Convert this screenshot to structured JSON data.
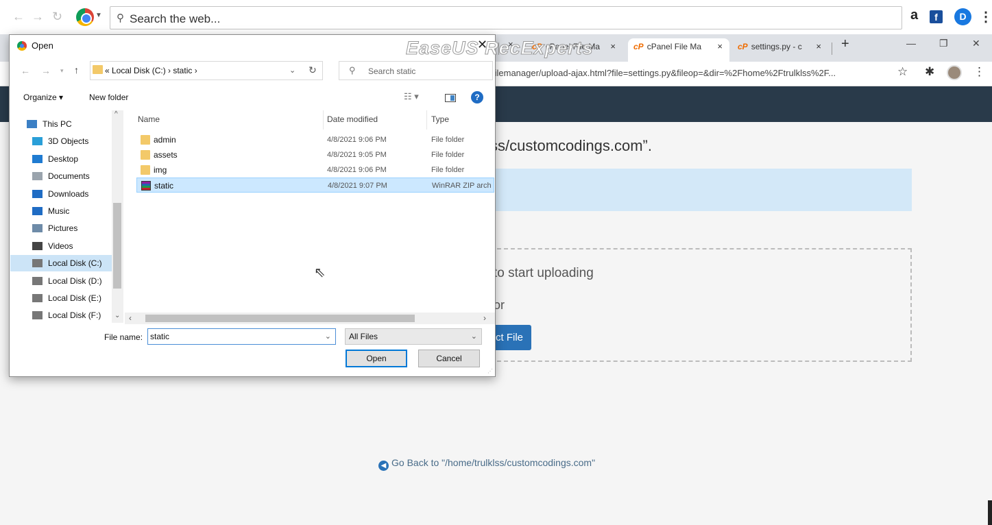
{
  "browser": {
    "search_text": "Search the web...",
    "address_url": "filemanager/upload-ajax.html?file=settings.py&fileop=&dir=%2Fhome%2Ftrulklss%2F...",
    "extensions": {
      "amazon": "a",
      "facebook": "f",
      "d_icon": "D"
    },
    "tabs": [
      {
        "label": "cPanel File Ma",
        "active": false
      },
      {
        "label": "cPanel File Ma",
        "active": true
      },
      {
        "label": "settings.py - c",
        "active": false
      }
    ],
    "cp_logo": "cP",
    "new_tab": "+",
    "tab_close": "×"
  },
  "watermark": "EaseUS RecExperts",
  "page": {
    "heading": "ss/customcodings.com”.",
    "dropzone_line1": "to start uploading",
    "dropzone_line2": "or",
    "select_button": "ct File",
    "go_back": "Go Back to \"/home/trulklss/customcodings.com\""
  },
  "dialog": {
    "title": "Open",
    "breadcrumb": "«  Local Disk (C:)  ›  static  ›",
    "search_placeholder": "Search static",
    "organize": "Organize ▾",
    "new_folder": "New folder",
    "nav_items": [
      {
        "label": "This PC",
        "icon": "pc-icon",
        "color": "#3b7fc4"
      },
      {
        "label": "3D Objects",
        "icon": "cube-icon",
        "color": "#2a9fd8"
      },
      {
        "label": "Desktop",
        "icon": "desktop-icon",
        "color": "#1f7bd1"
      },
      {
        "label": "Documents",
        "icon": "document-icon",
        "color": "#9aa4ad"
      },
      {
        "label": "Downloads",
        "icon": "download-icon",
        "color": "#1f6cc4"
      },
      {
        "label": "Music",
        "icon": "music-icon",
        "color": "#1f6cc4"
      },
      {
        "label": "Pictures",
        "icon": "pictures-icon",
        "color": "#6e8ba8"
      },
      {
        "label": "Videos",
        "icon": "videos-icon",
        "color": "#444444"
      },
      {
        "label": "Local Disk (C:)",
        "icon": "drive-icon",
        "color": "#777777"
      },
      {
        "label": "Local Disk (D:)",
        "icon": "drive-icon",
        "color": "#777777"
      },
      {
        "label": "Local Disk (E:)",
        "icon": "drive-icon",
        "color": "#777777"
      },
      {
        "label": "Local Disk (F:)",
        "icon": "drive-icon",
        "color": "#777777"
      }
    ],
    "selected_nav": "Local Disk (C:)",
    "columns": {
      "name": "Name",
      "date": "Date modified",
      "type": "Type"
    },
    "files": [
      {
        "name": "admin",
        "date": "4/8/2021 9:06 PM",
        "type": "File folder",
        "icon": "folder-icon"
      },
      {
        "name": "assets",
        "date": "4/8/2021 9:05 PM",
        "type": "File folder",
        "icon": "folder-icon"
      },
      {
        "name": "img",
        "date": "4/8/2021 9:06 PM",
        "type": "File folder",
        "icon": "folder-icon"
      },
      {
        "name": "static",
        "date": "4/8/2021 9:07 PM",
        "type": "WinRAR ZIP arch",
        "icon": "winrar-icon"
      }
    ],
    "selected_file": "static",
    "file_name_label": "File name:",
    "file_name_value": "static",
    "file_type_filter": "All Files",
    "open_button": "Open",
    "cancel_button": "Cancel"
  }
}
